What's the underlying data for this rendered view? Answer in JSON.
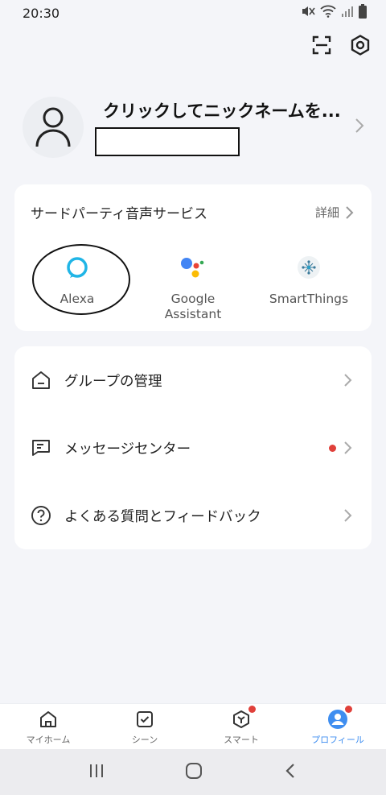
{
  "status_bar": {
    "time": "20:30"
  },
  "top_actions": {
    "scan_icon": "scan-icon",
    "settings_icon": "settings-icon"
  },
  "profile": {
    "nickname": "クリックしてニックネームを..."
  },
  "voice_services": {
    "title": "サードパーティ音声サービス",
    "detail_label": "詳細",
    "items": [
      {
        "name": "Alexa",
        "icon": "alexa-icon"
      },
      {
        "name": "Google\nAssistant",
        "icon": "google-assistant-icon"
      },
      {
        "name": "SmartThings",
        "icon": "smartthings-icon"
      }
    ]
  },
  "menu": {
    "items": [
      {
        "label": "グループの管理",
        "icon": "home-icon"
      },
      {
        "label": "メッセージセンター",
        "icon": "message-icon"
      },
      {
        "label": "よくある質問とフィードバック",
        "icon": "help-icon"
      }
    ]
  },
  "bottom_nav": {
    "items": [
      {
        "label": "マイホーム",
        "icon": "home-icon"
      },
      {
        "label": "シーン",
        "icon": "scene-icon"
      },
      {
        "label": "スマート",
        "icon": "smart-icon"
      },
      {
        "label": "プロフィール",
        "icon": "profile-icon"
      }
    ],
    "active_index": 3
  },
  "colors": {
    "accent": "#3f8ef0",
    "badge": "#e0403a",
    "alexa": "#20b5e6",
    "background": "#f4f5f9"
  }
}
